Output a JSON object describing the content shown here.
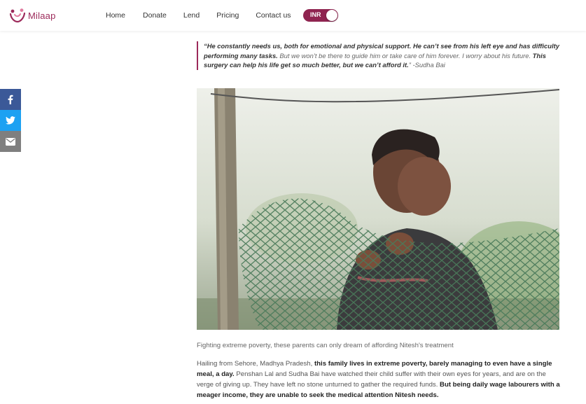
{
  "header": {
    "logo_text": "Milaap",
    "nav": [
      "Home",
      "Donate",
      "Lend",
      "Pricing",
      "Contact us"
    ],
    "currency_toggle": "INR"
  },
  "share": {
    "items": [
      "facebook-icon",
      "twitter-icon",
      "email-icon"
    ]
  },
  "quote": {
    "part1": "“He constantly needs us, both for emotional and physical support. He can’t see from his left eye and has difficulty performing many tasks.",
    "part2": " But we won’t be there to guide him or take care of him forever. I worry about his future.",
    "part3": " This surgery can help his life get so much better, but we can’t afford it.",
    "part4": "” -Sudha Bai"
  },
  "caption": "Fighting extreme poverty, these parents can only dream of affording Nitesh's treatment",
  "story": {
    "s1": "Hailing from Sehore, Madhya Pradesh, ",
    "s2": "this family lives in extreme poverty, barely managing to even have a single meal, a day.",
    "s3": " Penshan Lal and Sudha Bai have watched their child suffer with their own eyes for years, and are on the verge of giving up. They have left no stone unturned to gather the required funds. ",
    "s4": "But being daily wage labourers with a meager income, they are unable to seek the medical attention Nitesh needs."
  },
  "colors": {
    "brand": "#9c2a5a",
    "facebook": "#3b5998",
    "twitter": "#1da1f2",
    "email": "#7f7f7f"
  }
}
